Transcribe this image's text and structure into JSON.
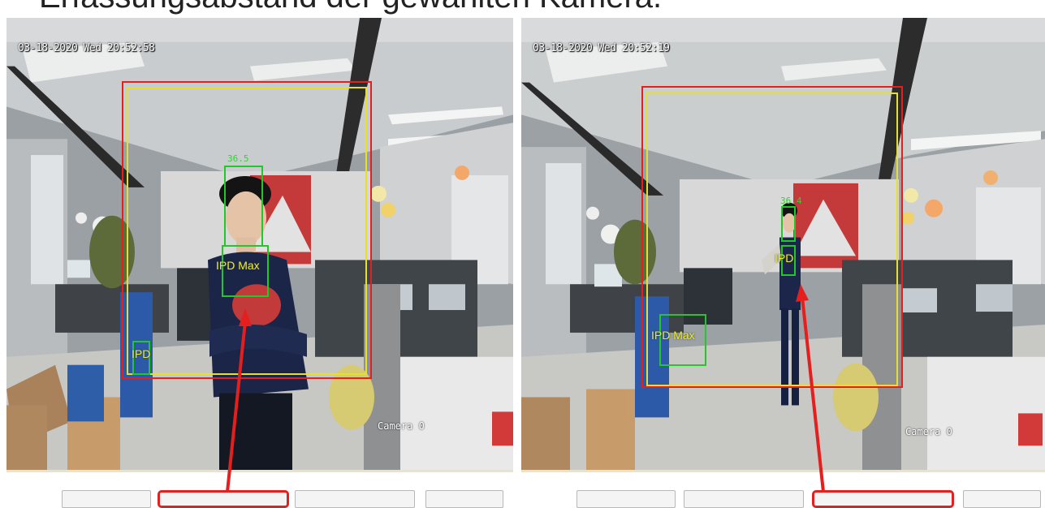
{
  "title": "Erfassungsabstand der gewählten Kamera.",
  "left_view": {
    "timestamp": "03-18-2020 Wed 20:52:58",
    "camera_label": "Camera 0",
    "face_value": "36.5",
    "labels": {
      "ipd_max": "IPD Max",
      "ipd": "IPD"
    }
  },
  "right_view": {
    "timestamp": "03-18-2020 Wed 20:52:19",
    "camera_label": "Camera 0",
    "face_value": "36.4",
    "labels": {
      "ipd_max": "IPD Max",
      "ipd": "IPD"
    }
  },
  "colors": {
    "red_frame": "#e51e1e",
    "yellow_frame": "#e6df2e",
    "green_box": "#24c72a",
    "arrow": "#e51e1e"
  },
  "icons": [
    "arrow-icon"
  ]
}
